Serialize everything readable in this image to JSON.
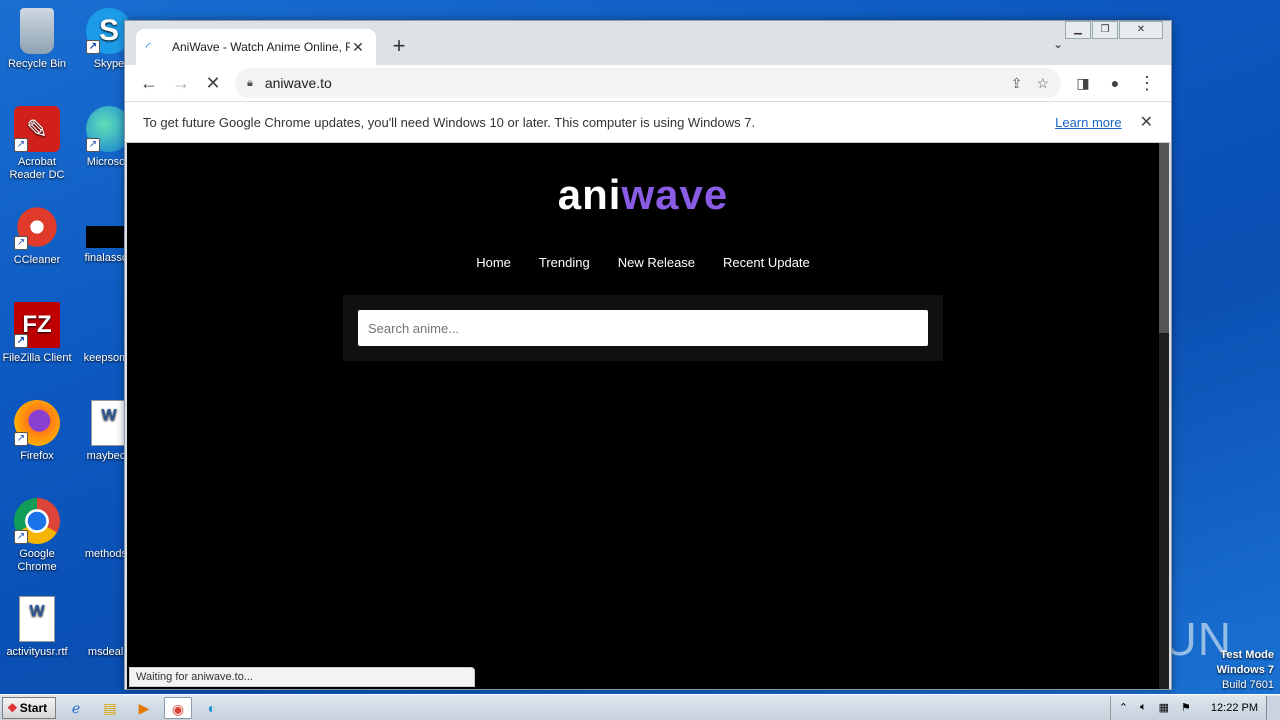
{
  "desktop": {
    "icons": [
      {
        "label": "Recycle Bin"
      },
      {
        "label": "Skype"
      },
      {
        "label": "Acrobat Reader DC"
      },
      {
        "label": "Microsoft"
      },
      {
        "label": "CCleaner"
      },
      {
        "label": "finalassoc"
      },
      {
        "label": "FileZilla Client"
      },
      {
        "label": "keepsome"
      },
      {
        "label": "Firefox"
      },
      {
        "label": "maybeca"
      },
      {
        "label": "Google Chrome"
      },
      {
        "label": "methodsp"
      },
      {
        "label": "activityusr.rtf"
      },
      {
        "label": "msdeal.r"
      }
    ],
    "watermark": "ANY ▷ RUN",
    "test_mode": {
      "line1": "Test Mode",
      "line2": "Windows 7",
      "line3": "Build 7601"
    }
  },
  "browser": {
    "tab": {
      "title": "AniWave - Watch Anime Online, Free"
    },
    "url": "aniwave.to",
    "infobar": {
      "message": "To get future Google Chrome updates, you'll need Windows 10 or later. This computer is using Windows 7.",
      "link": "Learn more"
    },
    "status": "Waiting for aniwave.to..."
  },
  "page": {
    "logo_a": "ani",
    "logo_w": "wave",
    "nav": [
      "Home",
      "Trending",
      "New Release",
      "Recent Update"
    ],
    "search_placeholder": "Search anime..."
  },
  "taskbar": {
    "start": "Start",
    "clock": "12:22 PM"
  }
}
